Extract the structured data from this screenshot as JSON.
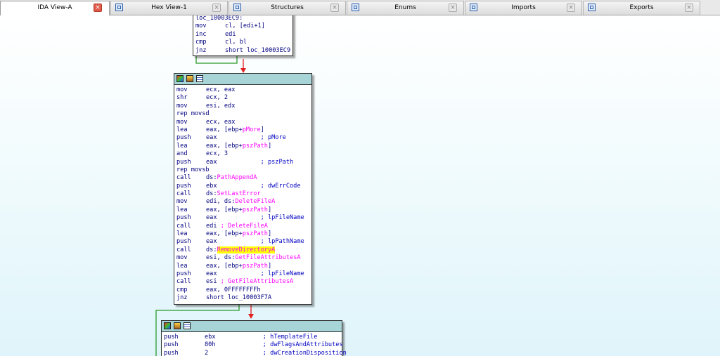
{
  "tabs": [
    {
      "label": "IDA View-A",
      "icon": "ida-view-icon",
      "active": true
    },
    {
      "label": "Hex View-1",
      "icon": "hex-view-icon",
      "active": false
    },
    {
      "label": "Structures",
      "icon": "structures-icon",
      "active": false
    },
    {
      "label": "Enums",
      "icon": "enums-icon",
      "active": false
    },
    {
      "label": "Imports",
      "icon": "imports-icon",
      "active": false
    },
    {
      "label": "Exports",
      "icon": "exports-icon",
      "active": false
    }
  ],
  "close_glyph": "×",
  "blocks": {
    "top": {
      "lines": [
        {
          "label": "loc_10003EC9:"
        },
        {
          "parts": [
            {
              "t": "mn",
              "v": "mov"
            },
            {
              "t": "tx",
              "v": "cl, [edi+1]"
            }
          ]
        },
        {
          "parts": [
            {
              "t": "mn",
              "v": "inc"
            },
            {
              "t": "tx",
              "v": "edi"
            }
          ]
        },
        {
          "parts": [
            {
              "t": "mn",
              "v": "cmp"
            },
            {
              "t": "tx",
              "v": "cl, bl"
            }
          ]
        },
        {
          "parts": [
            {
              "t": "mn",
              "v": "jnz"
            },
            {
              "t": "tx",
              "v": "short loc_10003EC9"
            }
          ]
        }
      ]
    },
    "middle": {
      "lines": [
        {
          "parts": [
            {
              "t": "mn",
              "v": "mov"
            },
            {
              "t": "tx",
              "v": "ecx, eax"
            }
          ]
        },
        {
          "parts": [
            {
              "t": "mn",
              "v": "shr"
            },
            {
              "t": "tx",
              "v": "ecx, 2"
            }
          ]
        },
        {
          "parts": [
            {
              "t": "mn",
              "v": "mov"
            },
            {
              "t": "tx",
              "v": "esi, edx"
            }
          ]
        },
        {
          "parts": [
            {
              "t": "tx",
              "v": "rep movsd"
            }
          ]
        },
        {
          "parts": [
            {
              "t": "mn",
              "v": "mov"
            },
            {
              "t": "tx",
              "v": "ecx, eax"
            }
          ]
        },
        {
          "parts": [
            {
              "t": "mn",
              "v": "lea"
            },
            {
              "t": "tx",
              "v": "eax, [ebp+"
            },
            {
              "t": "fn",
              "v": "pMore"
            },
            {
              "t": "tx",
              "v": "]"
            }
          ]
        },
        {
          "parts": [
            {
              "t": "mn",
              "v": "push"
            },
            {
              "t": "tx",
              "v": "eax            "
            },
            {
              "t": "cm",
              "v": "; pMore"
            }
          ]
        },
        {
          "parts": [
            {
              "t": "mn",
              "v": "lea"
            },
            {
              "t": "tx",
              "v": "eax, [ebp+"
            },
            {
              "t": "fn",
              "v": "pszPath"
            },
            {
              "t": "tx",
              "v": "]"
            }
          ]
        },
        {
          "parts": [
            {
              "t": "mn",
              "v": "and"
            },
            {
              "t": "tx",
              "v": "ecx, 3"
            }
          ]
        },
        {
          "parts": [
            {
              "t": "mn",
              "v": "push"
            },
            {
              "t": "tx",
              "v": "eax            "
            },
            {
              "t": "cm",
              "v": "; pszPath"
            }
          ]
        },
        {
          "parts": [
            {
              "t": "tx",
              "v": "rep movsb"
            }
          ]
        },
        {
          "parts": [
            {
              "t": "mn",
              "v": "call"
            },
            {
              "t": "tx",
              "v": "ds:"
            },
            {
              "t": "fn",
              "v": "PathAppendA"
            }
          ]
        },
        {
          "parts": [
            {
              "t": "mn",
              "v": "push"
            },
            {
              "t": "tx",
              "v": "ebx            "
            },
            {
              "t": "cm",
              "v": "; dwErrCode"
            }
          ]
        },
        {
          "parts": [
            {
              "t": "mn",
              "v": "call"
            },
            {
              "t": "tx",
              "v": "ds:"
            },
            {
              "t": "fn",
              "v": "SetLastError"
            }
          ]
        },
        {
          "parts": [
            {
              "t": "mn",
              "v": "mov"
            },
            {
              "t": "tx",
              "v": "edi, ds:"
            },
            {
              "t": "fn",
              "v": "DeleteFileA"
            }
          ]
        },
        {
          "parts": [
            {
              "t": "mn",
              "v": "lea"
            },
            {
              "t": "tx",
              "v": "eax, [ebp+"
            },
            {
              "t": "fn",
              "v": "pszPath"
            },
            {
              "t": "tx",
              "v": "]"
            }
          ]
        },
        {
          "parts": [
            {
              "t": "mn",
              "v": "push"
            },
            {
              "t": "tx",
              "v": "eax            "
            },
            {
              "t": "cm",
              "v": "; lpFileName"
            }
          ]
        },
        {
          "parts": [
            {
              "t": "mn",
              "v": "call"
            },
            {
              "t": "tx",
              "v": "edi "
            },
            {
              "t": "fn",
              "v": "; DeleteFileA"
            }
          ]
        },
        {
          "parts": [
            {
              "t": "mn",
              "v": "lea"
            },
            {
              "t": "tx",
              "v": "eax, [ebp+"
            },
            {
              "t": "fn",
              "v": "pszPath"
            },
            {
              "t": "tx",
              "v": "]"
            }
          ]
        },
        {
          "parts": [
            {
              "t": "mn",
              "v": "push"
            },
            {
              "t": "tx",
              "v": "eax            "
            },
            {
              "t": "cm",
              "v": "; lpPathName"
            }
          ]
        },
        {
          "parts": [
            {
              "t": "mn",
              "v": "call"
            },
            {
              "t": "tx",
              "v": "ds:"
            },
            {
              "t": "hl",
              "v": "RemoveDirectoryA"
            }
          ]
        },
        {
          "parts": [
            {
              "t": "mn",
              "v": "mov"
            },
            {
              "t": "tx",
              "v": "esi, ds:"
            },
            {
              "t": "fn",
              "v": "GetFileAttributesA"
            }
          ]
        },
        {
          "parts": [
            {
              "t": "mn",
              "v": "lea"
            },
            {
              "t": "tx",
              "v": "eax, [ebp+"
            },
            {
              "t": "fn",
              "v": "pszPath"
            },
            {
              "t": "tx",
              "v": "]"
            }
          ]
        },
        {
          "parts": [
            {
              "t": "mn",
              "v": "push"
            },
            {
              "t": "tx",
              "v": "eax            "
            },
            {
              "t": "cm",
              "v": "; lpFileName"
            }
          ]
        },
        {
          "parts": [
            {
              "t": "mn",
              "v": "call"
            },
            {
              "t": "tx",
              "v": "esi "
            },
            {
              "t": "fn",
              "v": "; GetFileAttributesA"
            }
          ]
        },
        {
          "parts": [
            {
              "t": "mn",
              "v": "cmp"
            },
            {
              "t": "tx",
              "v": "eax, 0FFFFFFFFh"
            }
          ]
        },
        {
          "parts": [
            {
              "t": "mn",
              "v": "jnz"
            },
            {
              "t": "tx",
              "v": "short loc_10003F7A"
            }
          ]
        }
      ]
    },
    "bottom": {
      "lines": [
        {
          "parts": [
            {
              "t": "mn",
              "v": "push"
            },
            {
              "t": "tx",
              "v": "ebx             "
            },
            {
              "t": "cm",
              "v": "; hTemplateFile"
            }
          ]
        },
        {
          "parts": [
            {
              "t": "mn",
              "v": "push"
            },
            {
              "t": "tx",
              "v": "80h             "
            },
            {
              "t": "cm",
              "v": "; dwFlagsAndAttributes"
            }
          ]
        },
        {
          "parts": [
            {
              "t": "mn",
              "v": "push"
            },
            {
              "t": "tx",
              "v": "2               "
            },
            {
              "t": "cm",
              "v": "; dwCreationDisposition"
            }
          ]
        }
      ]
    }
  },
  "colors": {
    "edge_true": "#2a9a2a",
    "edge_false": "#e02020",
    "header_bg": "#a7d4d7"
  }
}
